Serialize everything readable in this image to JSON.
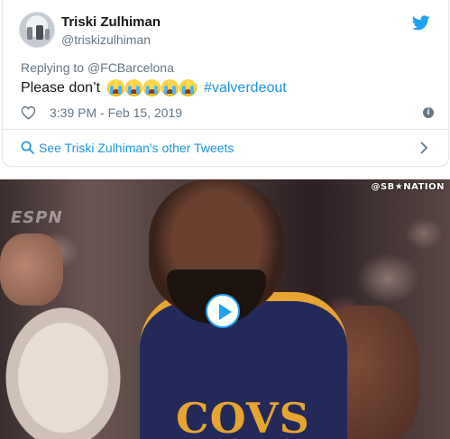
{
  "tweet": {
    "author_name": "Triski Zulhiman",
    "author_handle": "@triskizulhiman",
    "reply_prefix": "Replying to",
    "reply_to": "@FCBarcelona",
    "text": "Please don’t",
    "emoji_count": 5,
    "emoji": "loudly-crying-face",
    "hashtag": "#valverdeout",
    "timestamp": "3:39 PM - Feb 15, 2019",
    "see_other_label": "See Triski Zulhiman's other Tweets"
  },
  "video": {
    "watermark_top_right": "@SB★NATION",
    "watermark_left": "ESPN",
    "jersey_text": "COVS"
  },
  "icons": {
    "twitter": "twitter-bird-icon",
    "like": "heart-icon",
    "info": "info-icon",
    "search": "search-icon",
    "chevron": "chevron-right-icon",
    "play": "play-icon"
  },
  "colors": {
    "link": "#1b95e0",
    "muted": "#657786",
    "text": "#14171a",
    "twitter_blue": "#1da1f2"
  }
}
